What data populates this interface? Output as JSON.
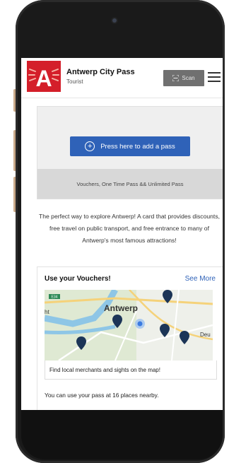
{
  "header": {
    "logo_letter": "A",
    "title": "Antwerp City Pass",
    "subtitle": "Tourist",
    "scan_label": "Scan",
    "scan_icon": "qr-scan-icon",
    "menu_icon": "hamburger-menu-icon"
  },
  "pass": {
    "add_button_label": "Press here to add a pass",
    "footer_text": "Vouchers, One Time Pass && Unlimited Pass"
  },
  "description": "The perfect way to explore Antwerp! A card that provides discounts, free travel on public transport, and free entrance to many of Antwerp's most famous attractions!",
  "vouchers": {
    "title": "Use your Vouchers!",
    "see_more": "See More",
    "map_city_label": "Antwerp",
    "map_label_left": "ht",
    "map_label_right": "Deu",
    "map_road_badge": "E34",
    "map_caption": "Find local merchants and sights on the map!",
    "nearby_text": "You can use your pass at 16 places nearby."
  },
  "colors": {
    "brand_red": "#d41f2a",
    "primary_blue": "#2f62b8",
    "scan_gray": "#707070",
    "water": "#8ec6e6",
    "pin": "#1c3557"
  }
}
